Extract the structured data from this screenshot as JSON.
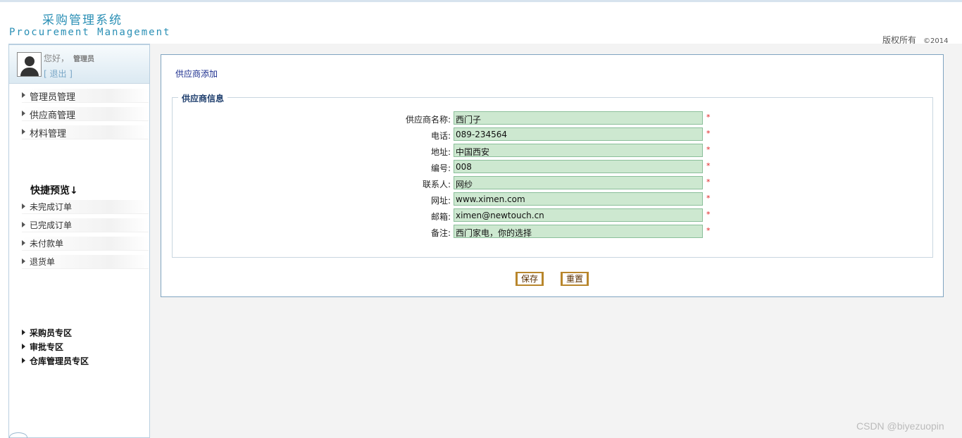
{
  "header": {
    "title_cn": "采购管理系统",
    "title_en": "Procurement Management",
    "copyright": "版权所有",
    "year": "©2014"
  },
  "user": {
    "greeting": "您好，",
    "name": "管理员",
    "logout": "[ 退出 ]"
  },
  "sidebar": {
    "menu": [
      {
        "label": "管理员管理"
      },
      {
        "label": "供应商管理"
      },
      {
        "label": "材料管理"
      }
    ],
    "quick_title": "快捷预览↓",
    "quick": [
      {
        "label": "未完成订单"
      },
      {
        "label": "已完成订单"
      },
      {
        "label": "未付款单"
      },
      {
        "label": "退货单"
      }
    ],
    "zones": [
      {
        "label": "采购员专区"
      },
      {
        "label": "审批专区"
      },
      {
        "label": "仓库管理员专区"
      }
    ]
  },
  "main": {
    "page_title": "供应商添加",
    "legend": "供应商信息",
    "required_mark": "*",
    "fields": [
      {
        "label": "供应商名称:",
        "value": "西门子"
      },
      {
        "label": "电话:",
        "value": "089-234564"
      },
      {
        "label": "地址:",
        "value": "中国西安"
      },
      {
        "label": "编号:",
        "value": "008"
      },
      {
        "label": "联系人:",
        "value": "网纱"
      },
      {
        "label": "网址:",
        "value": "www.ximen.com"
      },
      {
        "label": "邮箱:",
        "value": "ximen@newtouch.cn"
      },
      {
        "label": "备注:",
        "value": "西门家电，你的选择"
      }
    ],
    "save_label": "保存",
    "reset_label": "重置"
  },
  "watermark": "CSDN @biyezuopin"
}
